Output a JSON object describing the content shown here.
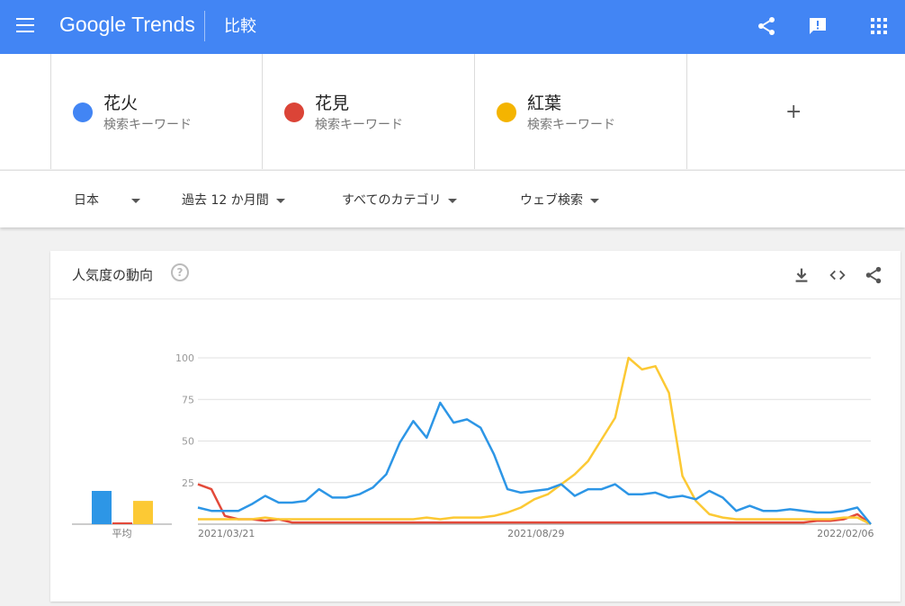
{
  "header": {
    "logo_google": "Google",
    "logo_trends": "Trends",
    "page_title": "比較",
    "icons": [
      "menu-icon",
      "share-icon",
      "feedback-icon",
      "apps-icon"
    ]
  },
  "terms": [
    {
      "name": "花火",
      "sub": "検索キーワード",
      "color": "#4285f4"
    },
    {
      "name": "花見",
      "sub": "検索キーワード",
      "color": "#db4437"
    },
    {
      "name": "紅葉",
      "sub": "検索キーワード",
      "color": "#f4b400"
    }
  ],
  "add_term": "+",
  "filters": {
    "region": "日本",
    "period": "過去 12 か月間",
    "category": "すべてのカテゴリ",
    "search_type": "ウェブ検索"
  },
  "card": {
    "title": "人気度の動向",
    "help": "?",
    "icons": [
      "download-icon",
      "embed-icon",
      "share-icon"
    ]
  },
  "chart_data": {
    "type": "line",
    "ylim": [
      0,
      100
    ],
    "yticks": [
      "100",
      "75",
      "50",
      "25"
    ],
    "xtick_labels": [
      {
        "label": "2021/03/21",
        "index": 0
      },
      {
        "label": "2021/08/29",
        "index": 23
      },
      {
        "label": "2022/02/06",
        "index": 46
      }
    ],
    "average_label": "平均",
    "averages": [
      20,
      1,
      14
    ],
    "series": [
      {
        "name": "花火",
        "color": "#2d96e6",
        "values": [
          10,
          8,
          8,
          8,
          12,
          17,
          13,
          13,
          14,
          21,
          16,
          16,
          18,
          22,
          30,
          49,
          62,
          52,
          73,
          61,
          63,
          58,
          42,
          21,
          19,
          20,
          21,
          24,
          17,
          21,
          21,
          24,
          18,
          18,
          19,
          16,
          17,
          15,
          20,
          16,
          8,
          11,
          8,
          8,
          9,
          8,
          7,
          7,
          8,
          10,
          0
        ]
      },
      {
        "name": "花見",
        "color": "#e34a3a",
        "values": [
          24,
          21,
          5,
          3,
          3,
          2,
          3,
          1,
          1,
          1,
          1,
          1,
          1,
          1,
          1,
          1,
          1,
          1,
          1,
          1,
          1,
          1,
          1,
          1,
          1,
          1,
          1,
          1,
          1,
          1,
          1,
          1,
          1,
          1,
          1,
          1,
          1,
          1,
          1,
          1,
          1,
          1,
          1,
          1,
          1,
          1,
          2,
          2,
          3,
          6,
          0
        ]
      },
      {
        "name": "紅葉",
        "color": "#fcc934",
        "values": [
          3,
          3,
          3,
          3,
          3,
          4,
          3,
          3,
          3,
          3,
          3,
          3,
          3,
          3,
          3,
          3,
          3,
          4,
          3,
          4,
          4,
          4,
          5,
          7,
          10,
          15,
          18,
          24,
          30,
          38,
          51,
          64,
          100,
          93,
          95,
          79,
          29,
          14,
          6,
          4,
          3,
          3,
          3,
          3,
          3,
          3,
          3,
          3,
          4,
          4,
          0
        ]
      }
    ]
  }
}
